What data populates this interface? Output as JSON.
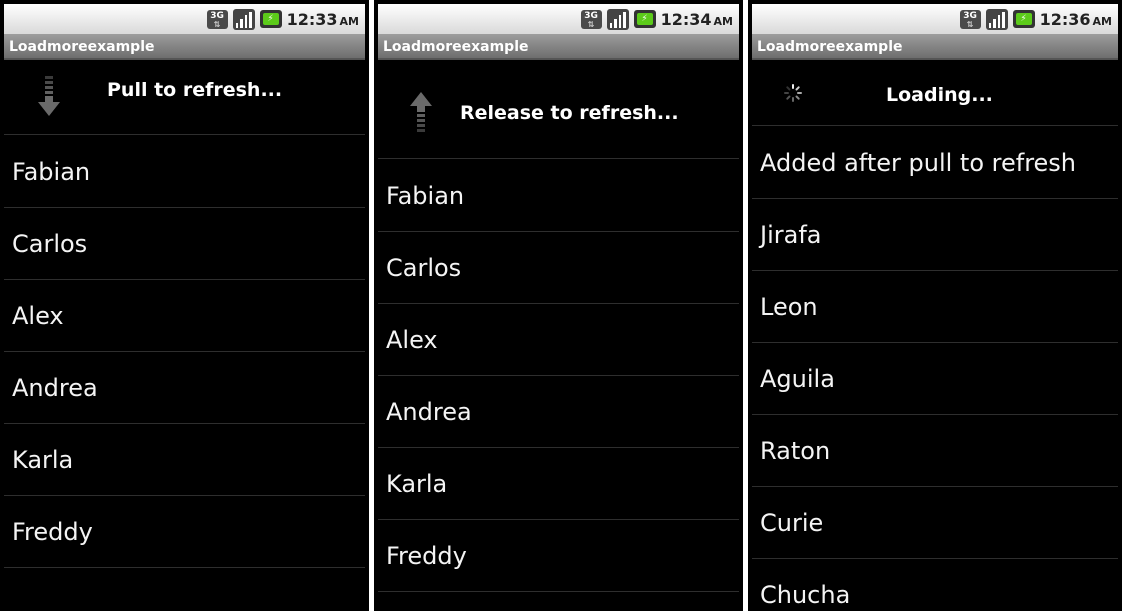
{
  "screens": [
    {
      "status": {
        "time": "12:33",
        "ampm": "AM",
        "network": "3G"
      },
      "app_title": "Loadmoreexample",
      "header": {
        "text": "Pull to refresh...",
        "icon": "arrow-down-icon"
      },
      "items": [
        "Fabian",
        "Carlos",
        "Alex",
        "Andrea",
        "Karla",
        "Freddy"
      ]
    },
    {
      "status": {
        "time": "12:34",
        "ampm": "AM",
        "network": "3G"
      },
      "app_title": "Loadmoreexample",
      "header": {
        "text": "Release to refresh...",
        "icon": "arrow-up-icon"
      },
      "items": [
        "Fabian",
        "Carlos",
        "Alex",
        "Andrea",
        "Karla",
        "Freddy"
      ]
    },
    {
      "status": {
        "time": "12:36",
        "ampm": "AM",
        "network": "3G"
      },
      "app_title": "Loadmoreexample",
      "header": {
        "text": "Loading...",
        "icon": "loading-spinner-icon"
      },
      "items": [
        "Added after pull to refresh",
        "Jirafa",
        "Leon",
        "Aguila",
        "Raton",
        "Curie",
        "Chucha"
      ]
    }
  ]
}
